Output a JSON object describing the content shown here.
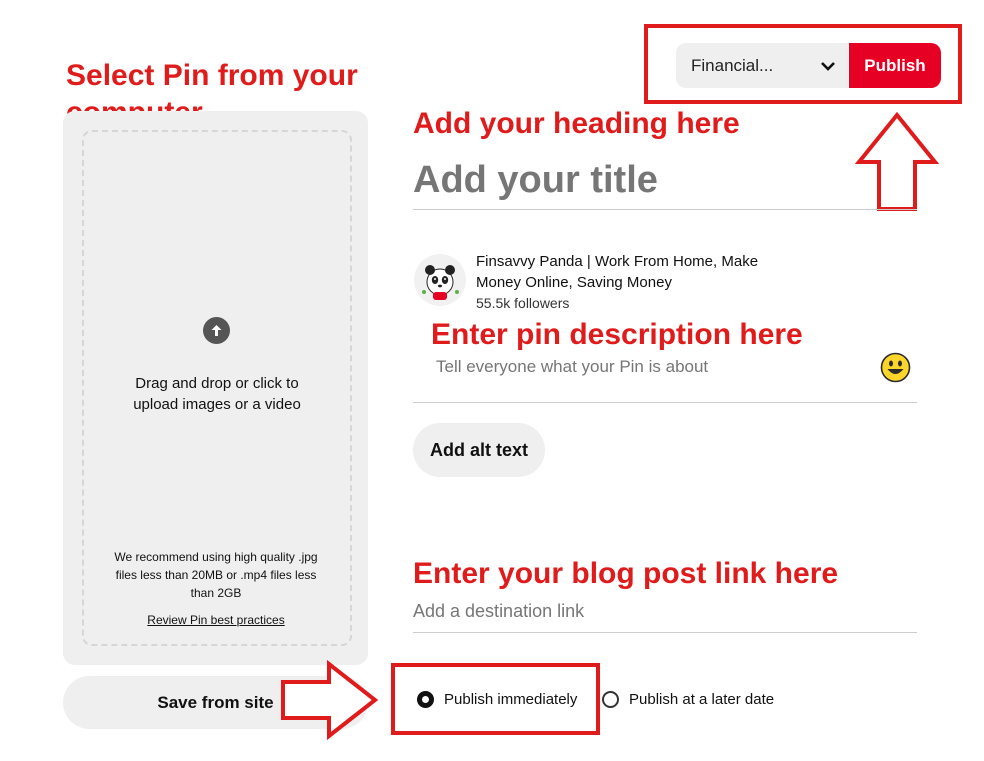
{
  "header": {
    "board_select_value": "Financial...",
    "publish_label": "Publish"
  },
  "annotations": {
    "select_pin": "Select Pin from your computer",
    "heading": "Add your heading here",
    "description": "Enter pin description here",
    "link": "Enter your blog post link here"
  },
  "upload": {
    "instruction_line1": "Drag and drop or click to",
    "instruction_line2": "upload images or a video",
    "recommend_line1": "We recommend using high quality .jpg",
    "recommend_line2": "files less than 20MB or .mp4 files less",
    "recommend_line3": "than 2GB",
    "best_practices_link": "Review Pin best practices"
  },
  "save_from_site_label": "Save from site",
  "title_placeholder": "Add your title",
  "account": {
    "name_line1": "Finsavvy Panda | Work From Home, Make",
    "name_line2": "Money Online, Saving Money",
    "followers": "55.5k followers"
  },
  "description_placeholder": "Tell everyone what your Pin is about",
  "alt_text_label": "Add alt text",
  "destination_placeholder": "Add a destination link",
  "publish_options": {
    "immediately": "Publish immediately",
    "later": "Publish at a later date",
    "selected": "immediately"
  },
  "colors": {
    "brand_red": "#e60023",
    "annotation_red": "#e01b1b"
  }
}
